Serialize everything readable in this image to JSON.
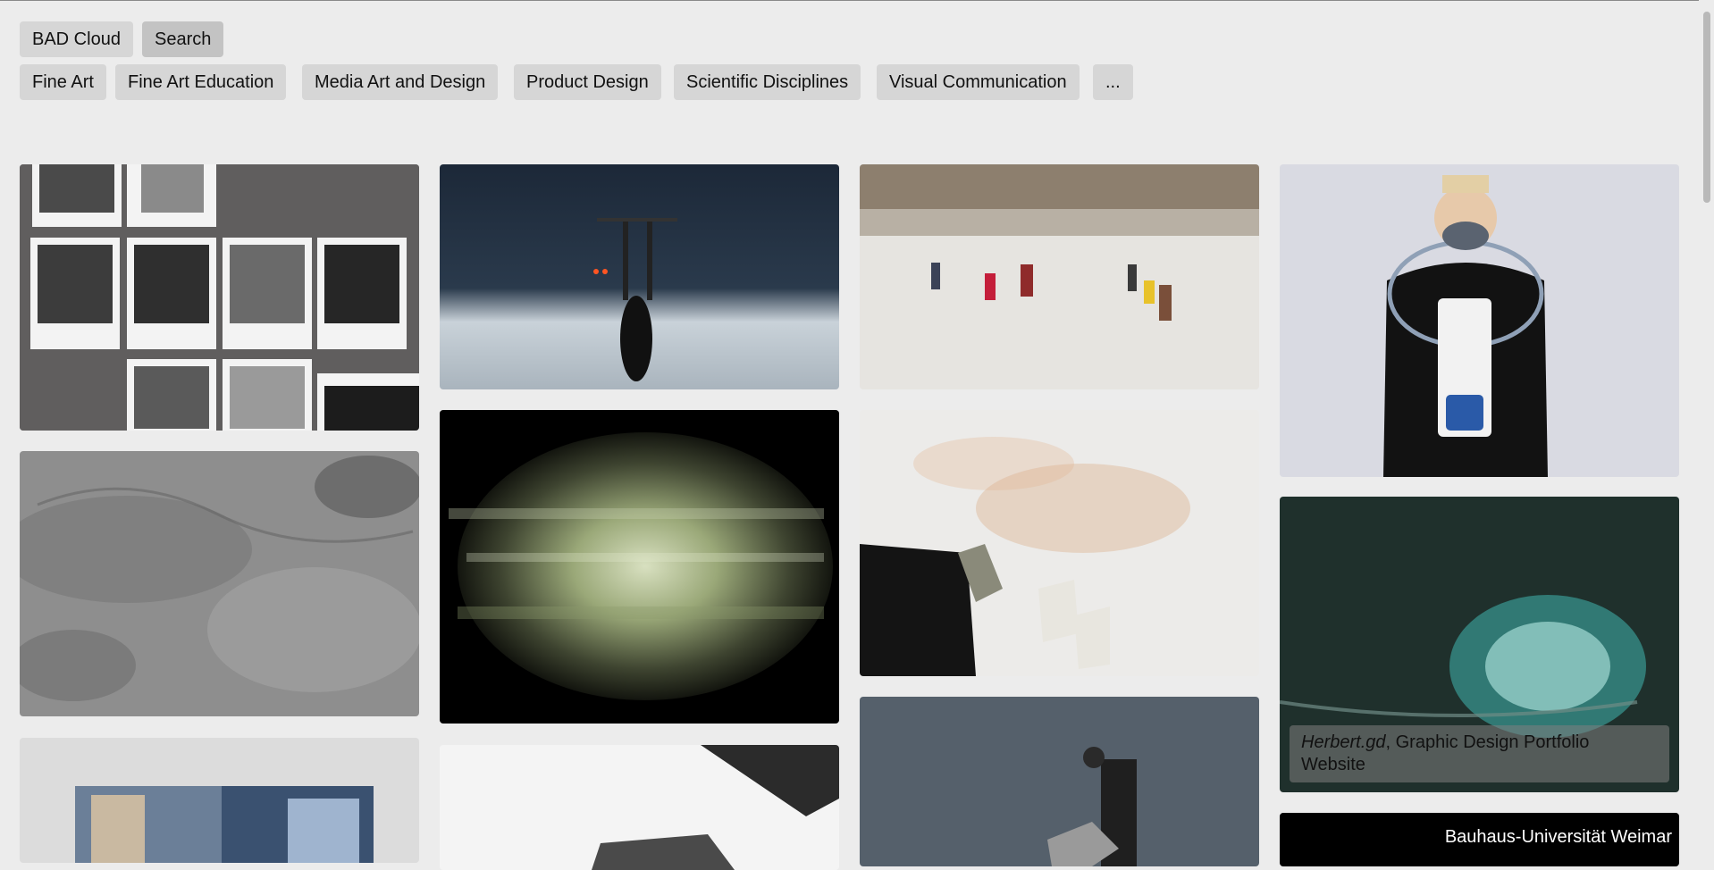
{
  "nav": {
    "primary": [
      "BAD Cloud",
      "Search"
    ],
    "categories": [
      "Fine Art",
      "Fine Art Education",
      "Media Art and Design",
      "Product Design",
      "Scientific Disciplines",
      "Visual Communication",
      "..."
    ]
  },
  "gallery": {
    "featured_caption": {
      "title": "Herbert.gd",
      "separator": ", ",
      "description": "Graphic Design Portfolio Website"
    },
    "brand_label": "Bauhaus-Universität Weimar"
  },
  "colors": {
    "background": "#ececec",
    "pill": "#d6d6d6",
    "pill_active": "#c3c3c3"
  }
}
